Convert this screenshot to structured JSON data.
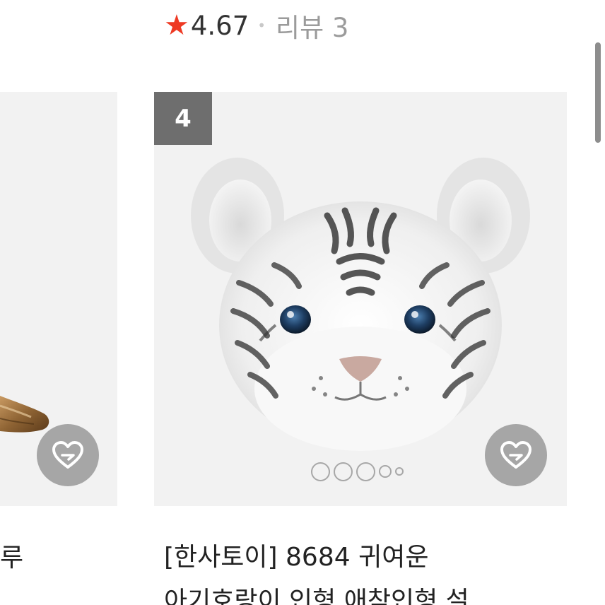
{
  "rating": {
    "star_icon": "star-icon",
    "score": "4.67",
    "separator": "•",
    "review_label": "리뷰 3"
  },
  "left_card": {
    "title_fragment": "루",
    "heart_icon": "wishlist-heart-icon"
  },
  "right_card": {
    "rank": "4",
    "image_subject": "white tiger cub plush",
    "carousel_dot_count": 5,
    "heart_icon": "wishlist-heart-icon",
    "title_line1": "[한사토이] 8684 귀여운",
    "title_line2": "아기호랑이 인형 애착인형 설"
  },
  "colors": {
    "star": "#ee3a24",
    "badge": "#6e6e6e",
    "card_bg": "#f2f2f2",
    "muted_text": "#9b9b9b"
  }
}
